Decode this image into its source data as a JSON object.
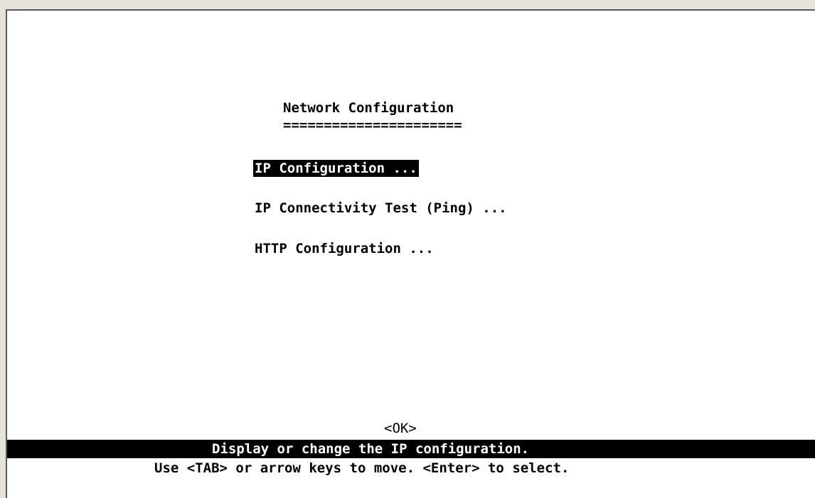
{
  "screen": {
    "title": "Network Configuration",
    "title_underline": "======================"
  },
  "menu": {
    "items": [
      {
        "label": "IP Configuration ...",
        "selected": true
      },
      {
        "label": "IP Connectivity Test (Ping) ...",
        "selected": false
      },
      {
        "label": "HTTP Configuration ...",
        "selected": false
      }
    ]
  },
  "ok_button": {
    "label": "<OK>"
  },
  "status_bar": {
    "text": "Display or change the IP configuration."
  },
  "help": {
    "text": "Use <TAB> or arrow keys to move. <Enter> to select."
  }
}
